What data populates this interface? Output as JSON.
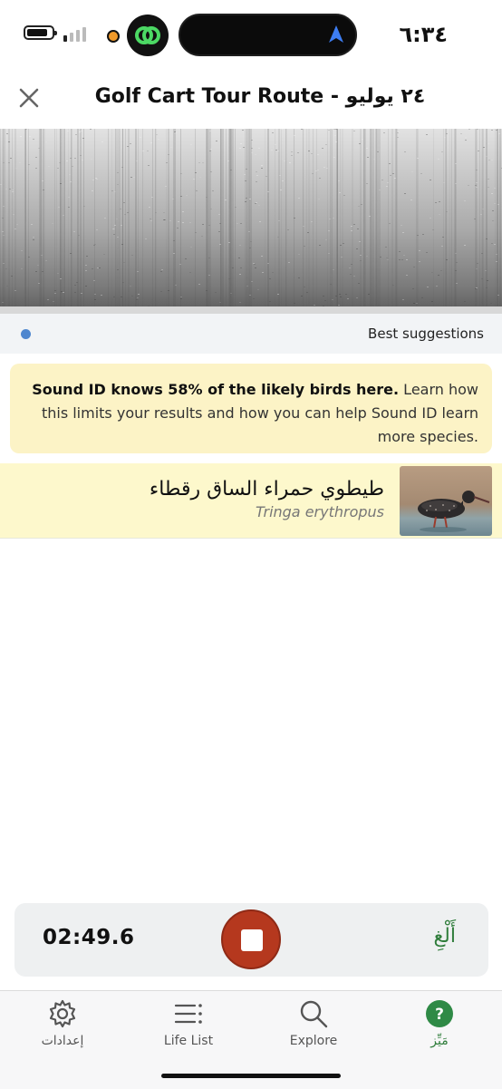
{
  "status_bar": {
    "time": "٦:٣٤",
    "icons": [
      "battery-icon",
      "signal-icon",
      "orange-dot-icon",
      "app-badge-icon",
      "location-arrow-icon"
    ]
  },
  "header": {
    "title": "Golf Cart Tour Route - ٢٤ يوليو",
    "close_icon": "close-icon"
  },
  "suggestions": {
    "label": "Best suggestions"
  },
  "info_banner": {
    "bold_text": "Sound ID knows 58% of the likely birds here.",
    "text": " Learn how this limits your results and how you can help Sound ID learn more species."
  },
  "species": [
    {
      "common_name": "طيطوي حمراء الساق رقطاء",
      "scientific_name": "Tringa erythropus"
    }
  ],
  "recorder": {
    "timer": "02:49.6",
    "cancel_label": "أَلْغِ",
    "stop_icon": "stop-icon"
  },
  "tabs": [
    {
      "label": "إعدادات",
      "icon": "gear-icon"
    },
    {
      "label": "Life List",
      "icon": "list-icon"
    },
    {
      "label": "Explore",
      "icon": "search-icon"
    },
    {
      "label": "مَيِّز",
      "icon": "help-icon",
      "active": true
    }
  ],
  "colors": {
    "accent_green": "#2f7d3b",
    "stop_red": "#b5381e",
    "banner_yellow": "#fcf3c6",
    "row_yellow": "#fdf8cc",
    "blue_dot": "#4f87cf"
  }
}
